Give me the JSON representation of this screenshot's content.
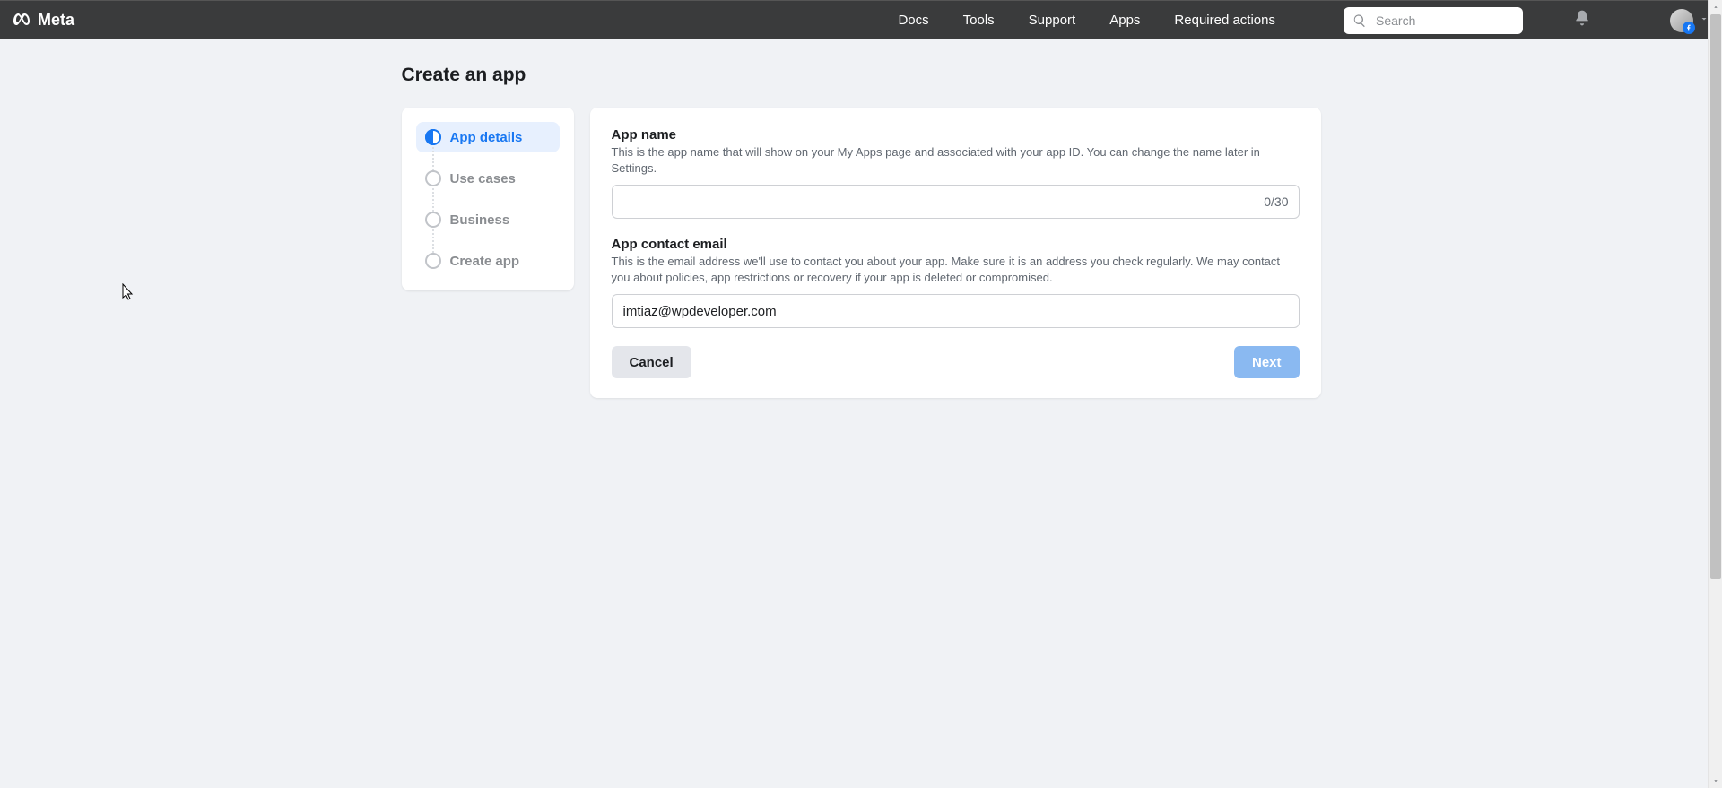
{
  "brand": "Meta",
  "nav": {
    "docs": "Docs",
    "tools": "Tools",
    "support": "Support",
    "apps": "Apps",
    "required_actions": "Required actions"
  },
  "search": {
    "placeholder": "Search"
  },
  "page": {
    "title": "Create an app"
  },
  "steps": {
    "app_details": "App details",
    "use_cases": "Use cases",
    "business": "Business",
    "create_app": "Create app"
  },
  "form": {
    "app_name": {
      "label": "App name",
      "help": "This is the app name that will show on your My Apps page and associated with your app ID. You can change the name later in Settings.",
      "counter": "0/30",
      "value": ""
    },
    "contact_email": {
      "label": "App contact email",
      "help": "This is the email address we'll use to contact you about your app. Make sure it is an address you check regularly. We may contact you about policies, app restrictions or recovery if your app is deleted or compromised.",
      "value": "imtiaz@wpdeveloper.com"
    },
    "cancel": "Cancel",
    "next": "Next"
  }
}
